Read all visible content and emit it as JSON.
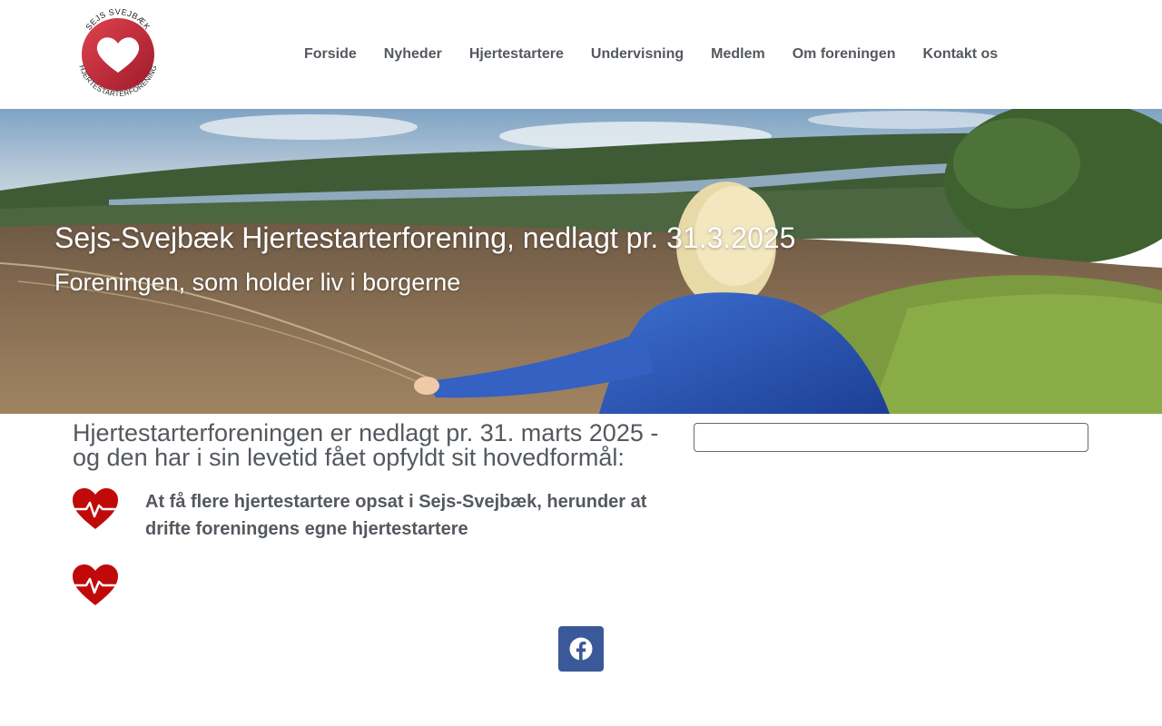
{
  "header": {
    "logo": {
      "text_top": "SEJS SVEJBÆK",
      "text_bottom": "HJERTESTARTERFORENING",
      "icon": "heart-logo-icon"
    },
    "nav": [
      {
        "label": "Forside"
      },
      {
        "label": "Nyheder"
      },
      {
        "label": "Hjertestartere"
      },
      {
        "label": "Undervisning"
      },
      {
        "label": "Medlem"
      },
      {
        "label": "Om foreningen"
      },
      {
        "label": "Kontakt os"
      }
    ]
  },
  "hero": {
    "title": "Sejs-Svejbæk Hjertestarterforening, nedlagt pr. 31.3.2025",
    "subtitle": "Foreningen, som holder liv i borgerne"
  },
  "main": {
    "intro": "Hjertestarterforeningen er nedlagt pr. 31. marts 2025 - og den har i sin levetid fået opfyldt sit hovedformål:",
    "features": [
      {
        "icon": "heartbeat-icon",
        "text": "At få flere hjertestartere opsat i Sejs-Svejbæk, herunder at drifte foreningens egne hjertestartere"
      },
      {
        "icon": "heartbeat-icon",
        "text": ""
      }
    ]
  },
  "social": {
    "facebook_icon": "facebook-icon"
  },
  "colors": {
    "text": "#54595f",
    "heart": "#c00a0a",
    "facebook": "#3b5998"
  }
}
